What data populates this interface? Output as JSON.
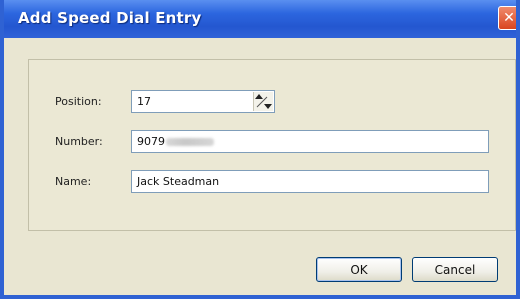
{
  "window": {
    "title": "Add Speed Dial Entry",
    "close_glyph": "✕"
  },
  "form": {
    "position_label": "Position:",
    "position_value": "17",
    "number_label": "Number:",
    "number_value_visible": "9079",
    "name_label": "Name:",
    "name_value": "Jack Steadman"
  },
  "buttons": {
    "ok_label": "OK",
    "cancel_label": "Cancel"
  },
  "icons": {
    "close": "close-icon",
    "spinner": "spinner-icon"
  }
}
